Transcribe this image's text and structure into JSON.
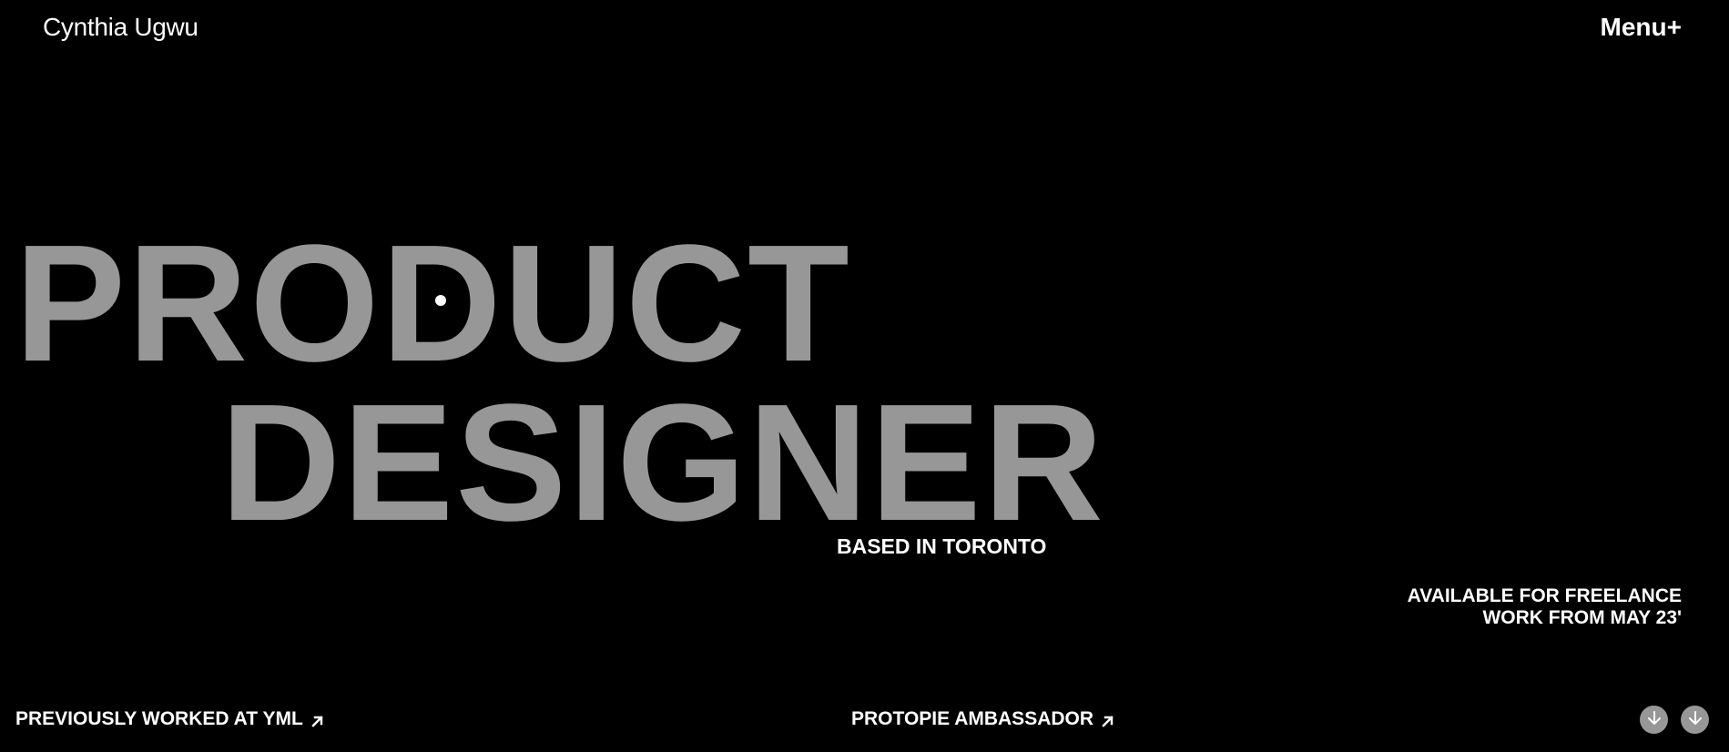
{
  "header": {
    "brand_name": "Cynthia Ugwu",
    "menu_label": "Menu+"
  },
  "hero": {
    "line1": "PRODUCT",
    "line2": "DESIGNER",
    "location": "BASED IN TORONTO",
    "availability_line1": "AVAILABLE FOR FREELANCE",
    "availability_line2": "WORK FROM MAY 23'"
  },
  "footer": {
    "previous_work_label": "PREVIOUSLY WORKED AT YML",
    "ambassador_label": "PROTOPIE AMBASSADOR"
  },
  "icons": {
    "external_link": "arrow-up-right-icon",
    "scroll_down": "arrow-down-icon"
  },
  "colors": {
    "background": "#000000",
    "text": "#ffffff",
    "hero_text": "#979797",
    "scroll_button": "#979797"
  }
}
